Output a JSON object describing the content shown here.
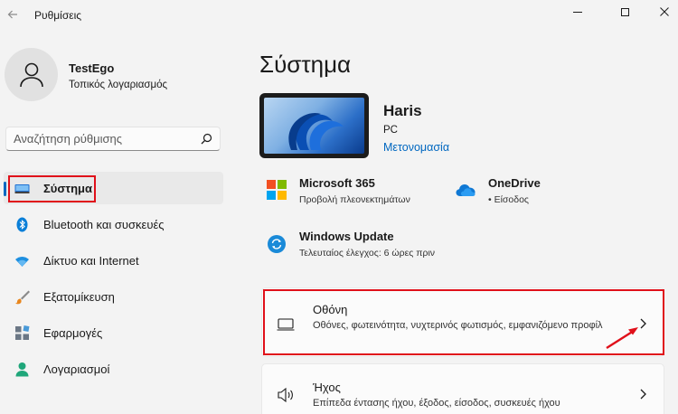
{
  "app": {
    "title": "Ρυθμίσεις"
  },
  "profile": {
    "name": "TestEgo",
    "account_type": "Τοπικός λογαριασμός"
  },
  "search": {
    "placeholder": "Αναζήτηση ρύθμισης"
  },
  "nav": {
    "items": [
      {
        "label": "Σύστημα",
        "icon": "monitor-icon",
        "active": true
      },
      {
        "label": "Bluetooth και συσκευές",
        "icon": "bluetooth-icon"
      },
      {
        "label": "Δίκτυο και Internet",
        "icon": "wifi-icon"
      },
      {
        "label": "Εξατομίκευση",
        "icon": "brush-icon"
      },
      {
        "label": "Εφαρμογές",
        "icon": "apps-icon"
      },
      {
        "label": "Λογαριασμοί",
        "icon": "person-icon"
      }
    ]
  },
  "main": {
    "title": "Σύστημα",
    "device": {
      "name": "Haris",
      "type": "PC",
      "rename_label": "Μετονομασία"
    },
    "tiles": [
      {
        "title": "Microsoft 365",
        "subtitle": "Προβολή πλεονεκτημάτων",
        "icon": "microsoft-logo-icon"
      },
      {
        "title": "OneDrive",
        "subtitle": "• Είσοδος",
        "icon": "cloud-icon"
      },
      {
        "title": "Windows Update",
        "subtitle": "Τελευταίος έλεγχος: 6 ώρες πριν",
        "icon": "update-icon"
      }
    ],
    "cards": [
      {
        "title": "Οθόνη",
        "subtitle": "Οθόνες, φωτεινότητα, νυχτερινός φωτισμός, εμφανιζόμενο προφίλ",
        "icon": "display-icon"
      },
      {
        "title": "Ήχος",
        "subtitle": "Επίπεδα έντασης ήχου, έξοδος, είσοδος, συσκευές ήχου",
        "icon": "speaker-icon"
      }
    ]
  },
  "colors": {
    "accent": "#0067c0",
    "annotation": "#e0101a",
    "background": "#f3f3f3"
  }
}
